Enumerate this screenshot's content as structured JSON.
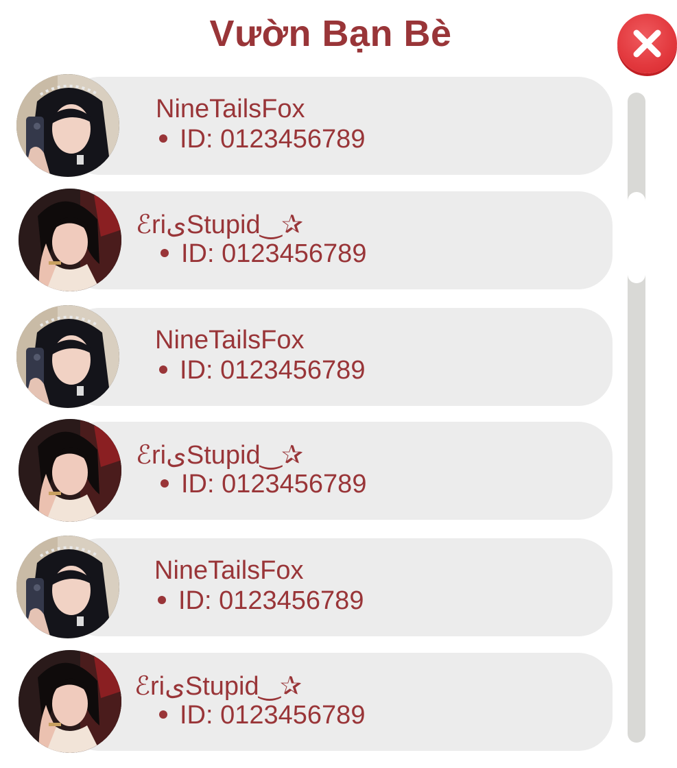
{
  "header": {
    "title": "Vườn Bạn Bè"
  },
  "close_icon": "close-x-icon",
  "colors": {
    "title": "#993538",
    "text": "#993538",
    "pill": "#ececec",
    "close": "#e2383d",
    "track": "#d9d9d6",
    "thumb": "#ffffff"
  },
  "friends": [
    {
      "name": "NineTailsFox",
      "id": "ID: 0123456789",
      "avatar": "avatar-girl-black-lace"
    },
    {
      "name": "ℰriیStupid‿✰",
      "id": "ID: 0123456789",
      "avatar": "avatar-girl-dark-hair"
    },
    {
      "name": "NineTailsFox",
      "id": "ID: 0123456789",
      "avatar": "avatar-girl-black-lace"
    },
    {
      "name": "ℰriیStupid‿✰",
      "id": "ID: 0123456789",
      "avatar": "avatar-girl-dark-hair"
    },
    {
      "name": "NineTailsFox",
      "id": "ID: 0123456789",
      "avatar": "avatar-girl-black-lace"
    },
    {
      "name": "ℰriیStupid‿✰",
      "id": "ID: 0123456789",
      "avatar": "avatar-girl-dark-hair"
    }
  ]
}
